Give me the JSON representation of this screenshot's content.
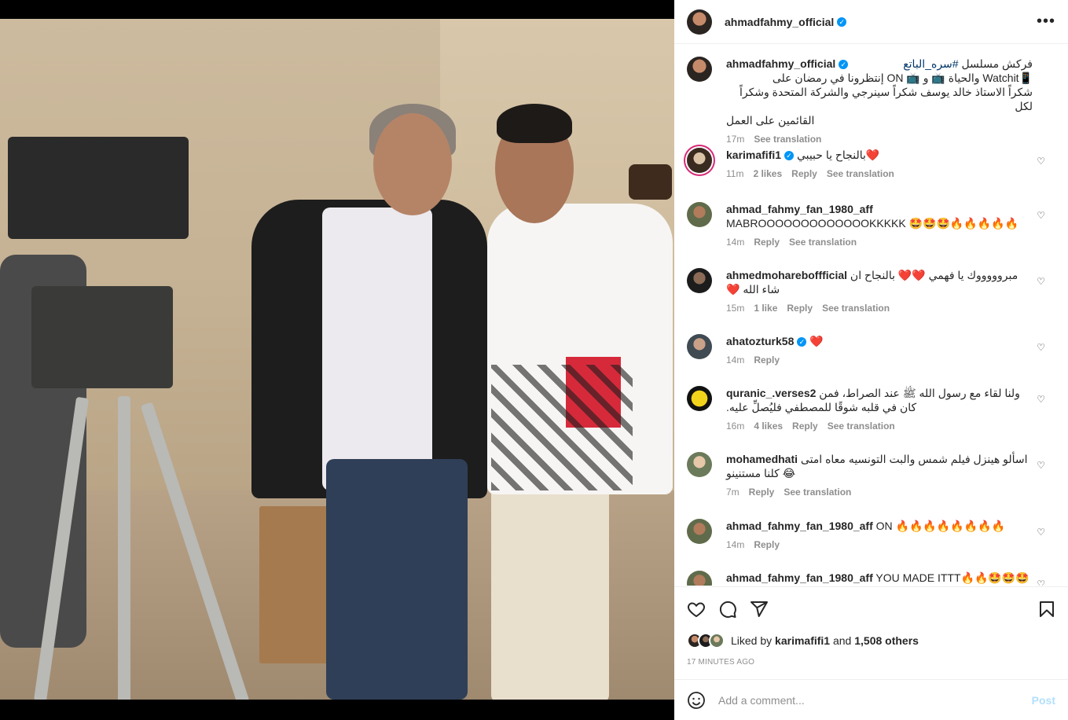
{
  "post": {
    "author": "ahmadfahmy_official",
    "more_icon": "more-horizontal-icon"
  },
  "caption": {
    "author": "ahmadfahmy_official",
    "line1_prefix": "فركش مسلسل ",
    "hashtag": "#سره_الباتع",
    "line2": "📱Watchit والحياة 📺 و 📺 ON إنتظرونا في رمضان على",
    "line3": "شكراً الاستاذ خالد يوسف شكراً سينرجي والشركة المتحدة وشكراً لكل",
    "line4": "القائمين على العمل",
    "time": "17m",
    "see_translation": "See translation"
  },
  "comments": [
    {
      "user": "karimafifi1",
      "verified": true,
      "text": "بالنجاح يا حبيبي❤️",
      "rtl": true,
      "time": "11m",
      "likes": "2 likes",
      "reply": "Reply",
      "translate": "See translation"
    },
    {
      "user": "ahmad_fahmy_fan_1980_aff",
      "verified": false,
      "text": "MABROOOOOOOOOOOOOKKKKK 🤩🤩🤩🔥🔥🔥🔥🔥",
      "rtl": false,
      "time": "14m",
      "likes": "",
      "reply": "Reply",
      "translate": "See translation"
    },
    {
      "user": "ahmedmohareboffficial",
      "verified": false,
      "text": "مبروووووك يا فهمي ❤️❤️ بالنجاح ان شاء الله ❤️",
      "rtl": true,
      "time": "15m",
      "likes": "1 like",
      "reply": "Reply",
      "translate": "See translation"
    },
    {
      "user": "ahatozturk58",
      "verified": true,
      "text": "❤️",
      "rtl": false,
      "time": "14m",
      "likes": "",
      "reply": "Reply",
      "translate": ""
    },
    {
      "user": "quranic_.verses2",
      "verified": false,
      "text": "ولنا لقاء مع رسول الله ﷺ عند الصراط، فمن كان في قلبه شوقًا للمصطفي فليُصلِّ عليه.",
      "rtl": true,
      "time": "16m",
      "likes": "4 likes",
      "reply": "Reply",
      "translate": "See translation"
    },
    {
      "user": "mohamedhati",
      "verified": false,
      "text": "اسألو هينزل فيلم شمس والبت التونسيه معاه امتى 😂 كلنا مستنينو",
      "rtl": true,
      "time": "7m",
      "likes": "",
      "reply": "Reply",
      "translate": "See translation"
    },
    {
      "user": "ahmad_fahmy_fan_1980_aff",
      "verified": false,
      "text": "ON 🔥🔥🔥🔥🔥🔥🔥🔥",
      "rtl": false,
      "time": "14m",
      "likes": "",
      "reply": "Reply",
      "translate": ""
    },
    {
      "user": "ahmad_fahmy_fan_1980_aff",
      "verified": false,
      "text": "YOU MADE ITTT🔥🔥🤩🤩🤩🤩",
      "rtl": false,
      "time": "",
      "likes": "",
      "reply": "",
      "translate": ""
    }
  ],
  "actions": {
    "like_icon": "heart-icon",
    "comment_icon": "comment-icon",
    "share_icon": "share-icon",
    "save_icon": "bookmark-icon"
  },
  "likes": {
    "prefix": "Liked by",
    "user": "karimafifi1",
    "middle": "and",
    "count": "1,508 others"
  },
  "timestamp": "17 MINUTES AGO",
  "add_comment": {
    "placeholder": "Add a comment...",
    "post_label": "Post",
    "emoji_icon": "smile-icon"
  }
}
